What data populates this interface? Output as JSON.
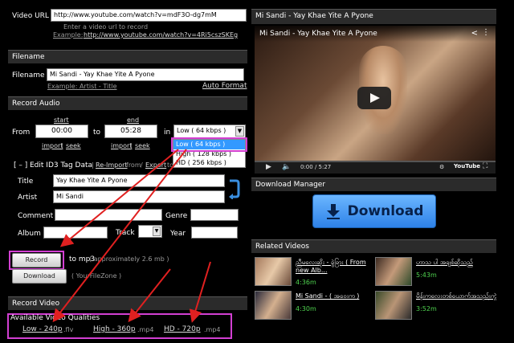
{
  "video_url": {
    "label": "Video URL",
    "value": "http://www.youtube.com/watch?v=mdF3O-dg7mM",
    "hint": "Enter a video url to record",
    "example_label": "Example:",
    "example_link": "http://www.youtube.com/watch?v=4Ri5cszSKEg"
  },
  "filename": {
    "section": "Filename",
    "label": "Filename",
    "value": "Mi Sandi - Yay Khae Yite A Pyone",
    "example": "Example: Artist - Title",
    "auto_format": "Auto Format"
  },
  "record_audio": {
    "section": "Record Audio",
    "start_label": "start",
    "end_label": "end",
    "from_label": "From",
    "to_label": "to",
    "in_label": "in",
    "start_value": "00:00",
    "end_value": "05:28",
    "import": "import",
    "seek": "seek",
    "quality_selected": "Low ( 64 kbps )",
    "quality_options": [
      "Low ( 64 kbps )",
      "High ( 128 kbps )",
      "HD ( 256 kbps )"
    ]
  },
  "id3": {
    "toggle": "[ – ]",
    "label": "Edit ID3 Tag Data",
    "reimport": "Re-Import",
    "from": "from",
    "export": "Export",
    "to": "to",
    "title_label": "Title",
    "title_value": "Yay Khae Yite A Pyone",
    "artist_label": "Artist",
    "artist_value": "Mi Sandi",
    "comment_label": "Comment",
    "genre_label": "Genre",
    "album_label": "Album",
    "track_label": "Track",
    "year_label": "Year"
  },
  "actions": {
    "record": "Record",
    "to_mp3": "to mp3",
    "approx": "( approximately 2.6 mb )",
    "download": "Download",
    "yourfilezone": "( YourFileZone )"
  },
  "record_video": {
    "section": "Record Video",
    "available": "Available Video Qualities",
    "qualities": [
      {
        "name": "Low - 240p",
        "ext": ".flv"
      },
      {
        "name": "High - 360p",
        "ext": ".mp4"
      },
      {
        "name": "HD - 720p",
        "ext": ".mp4"
      }
    ]
  },
  "player": {
    "header": "Mi Sandi - Yay Khae Yite A Pyone",
    "title": "Mi Sandi - Yay Khae Yite A Pyone",
    "time": "0:00 / 5:27",
    "logo": "YouTube"
  },
  "download_manager": {
    "section": "Download Manager",
    "button": "Download"
  },
  "related": {
    "section": "Related Videos",
    "items": [
      {
        "title": "ညီမလေးဆိုး - ခွဲခြား ( From new Alb...",
        "duration": "4:36m"
      },
      {
        "title": "ဟာသ ပါ အချစ်ဆိုသည်",
        "duration": "5:43m"
      },
      {
        "title": "Mi Sandi - ( အဝေးက )",
        "duration": "4:30m"
      },
      {
        "title": "မိန်းကလေးတစ်ယောက်အသည်းကွဲချိန်",
        "duration": "3:52m"
      }
    ]
  },
  "colors": {
    "highlight": "#d23fd2",
    "arrow": "#e02020",
    "download_button": "#3b8df0",
    "duration_green": "#4fd34f"
  }
}
